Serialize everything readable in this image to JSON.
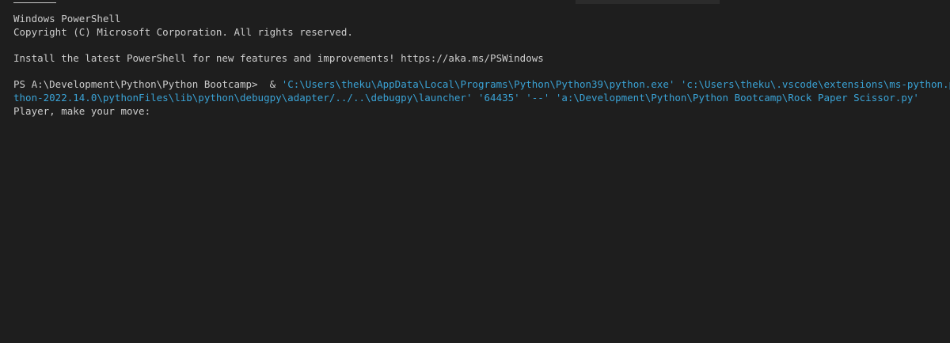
{
  "terminal": {
    "header_line1": "Windows PowerShell",
    "header_line2": "Copyright (C) Microsoft Corporation. All rights reserved.",
    "install_notice": "Install the latest PowerShell for new features and improvements! https://aka.ms/PSWindows",
    "prompt": "PS A:\\Development\\Python\\Python Bootcamp>",
    "operator": "&",
    "command_line1_args": "'C:\\Users\\theku\\AppData\\Local\\Programs\\Python\\Python39\\python.exe' 'c:\\Users\\theku\\.vscode\\extensions\\ms-python.py",
    "command_line2_args": "thon-2022.14.0\\pythonFiles\\lib\\python\\debugpy\\adapter/../..\\debugpy\\launcher' '64435' '--' 'a:\\Development\\Python\\Python Bootcamp\\Rock Paper Scissor.py'",
    "program_output": "Player, make your move:"
  },
  "colors": {
    "background": "#1e1e1e",
    "foreground": "#cccccc",
    "string": "#3aa3d6"
  }
}
